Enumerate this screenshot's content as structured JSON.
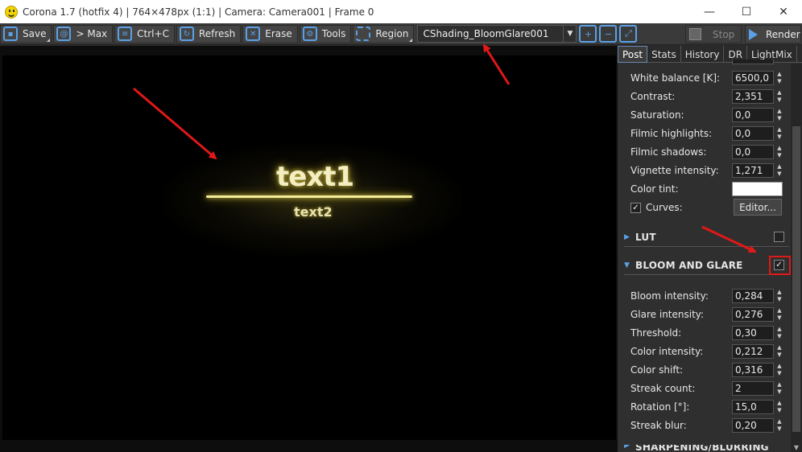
{
  "window": {
    "title": "Corona 1.7 (hotfix 4) | 764×478px (1:1) | Camera: Camera001 | Frame 0",
    "minimize_label": "—",
    "maximize_label": "☐",
    "close_label": "✕"
  },
  "toolbar": {
    "save_label": "Save",
    "max_label": "> Max",
    "copy_label": "Ctrl+C",
    "refresh_label": "Refresh",
    "erase_label": "Erase",
    "tools_label": "Tools",
    "region_label": "Region",
    "shading_select_value": "CShading_BloomGlare001",
    "stop_label": "Stop",
    "render_label": "Render"
  },
  "viewport": {
    "text1": "text1",
    "text2": "text2"
  },
  "panel": {
    "tabs": [
      "Post",
      "Stats",
      "History",
      "DR",
      "LightMix"
    ],
    "active_tab": "Post",
    "post_settings": [
      {
        "label": "White balance [K]:",
        "value": "6500,0"
      },
      {
        "label": "Contrast:",
        "value": "2,351"
      },
      {
        "label": "Saturation:",
        "value": "0,0"
      },
      {
        "label": "Filmic highlights:",
        "value": "0,0"
      },
      {
        "label": "Filmic shadows:",
        "value": "0,0"
      },
      {
        "label": "Vignette intensity:",
        "value": "1,271"
      }
    ],
    "color_tint_label": "Color tint:",
    "color_tint_value": "#ffffff",
    "curves_label": "Curves:",
    "curves_checked": true,
    "editor_label": "Editor...",
    "lut_title": "LUT",
    "lut_enabled": false,
    "bloom_title": "BLOOM AND GLARE",
    "bloom_enabled": true,
    "bloom_settings": [
      {
        "label": "Bloom intensity:",
        "value": "0,284"
      },
      {
        "label": "Glare intensity:",
        "value": "0,276"
      },
      {
        "label": "Threshold:",
        "value": "0,30"
      },
      {
        "label": "Color intensity:",
        "value": "0,212"
      },
      {
        "label": "Color shift:",
        "value": "0,316"
      },
      {
        "label": "Streak count:",
        "value": "2"
      },
      {
        "label": "Rotation [°]:",
        "value": "15,0"
      },
      {
        "label": "Streak blur:",
        "value": "0,20"
      }
    ],
    "next_section_title": "SHARPENING/BLURRING"
  },
  "colors": {
    "accent": "#5aa0e6",
    "annotation_arrow": "#e01818",
    "glow_text": "#f3efc2"
  }
}
